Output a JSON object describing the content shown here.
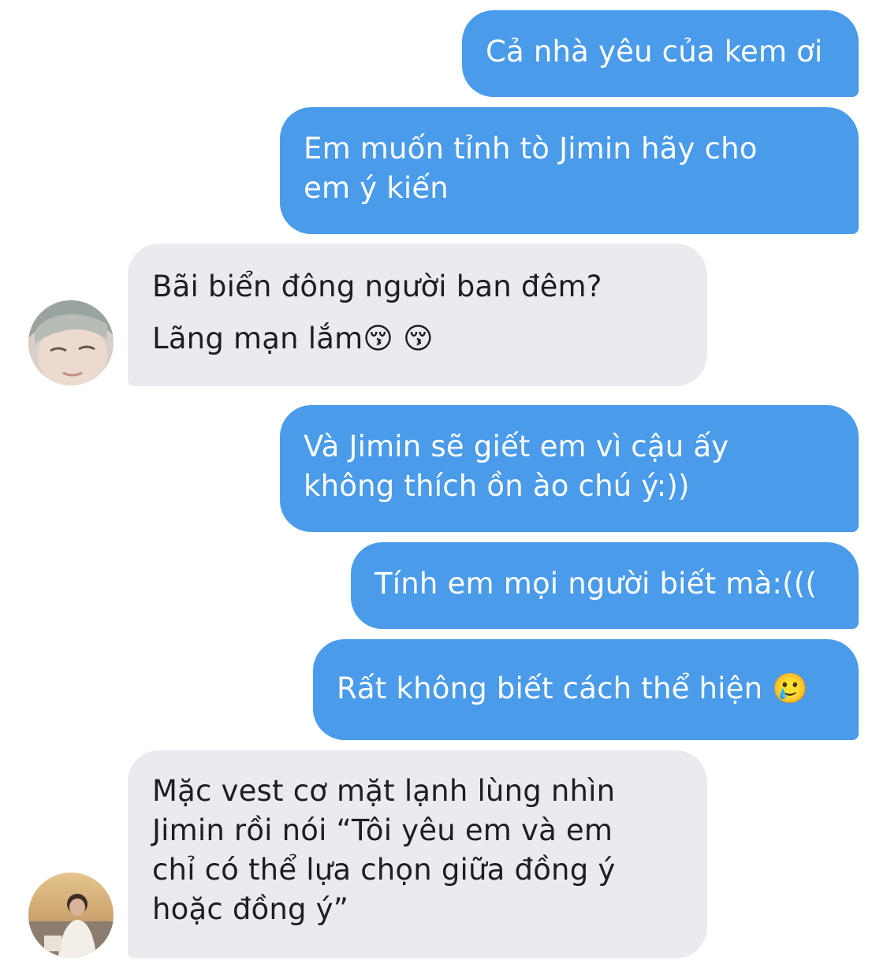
{
  "messages": [
    {
      "side": "sent",
      "lines": [
        "Cả nhà yêu của kem ơi"
      ]
    },
    {
      "side": "sent",
      "lines": [
        "Em muốn tỉnh tò Jimin hãy cho",
        "em ý kiến"
      ]
    },
    {
      "side": "received",
      "lines": [
        "Bãi biển đông người ban đêm?",
        "Lãng mạn lắm😚 😚"
      ]
    },
    {
      "side": "sent",
      "lines": [
        "Và Jimin sẽ giết em vì cậu ấy",
        "không thích ồn ào chú ý:))"
      ]
    },
    {
      "side": "sent",
      "lines": [
        "Tính em mọi người biết mà:((("
      ]
    },
    {
      "side": "sent",
      "lines": [
        "Rất không biết cách thể hiện 🥲"
      ]
    },
    {
      "side": "received",
      "lines": [
        "Mặc vest cơ mặt lạnh lùng nhìn",
        "Jimin rồi nói “Tôi yêu em và em",
        "chỉ có thể lựa chọn giữa đồng ý",
        "hoặc đồng ý”"
      ]
    }
  ],
  "colors": {
    "sent_bubble": "#4a9bea",
    "received_bubble": "#e9ebee",
    "sent_text": "#ffffff",
    "received_text": "#1c1e21"
  }
}
